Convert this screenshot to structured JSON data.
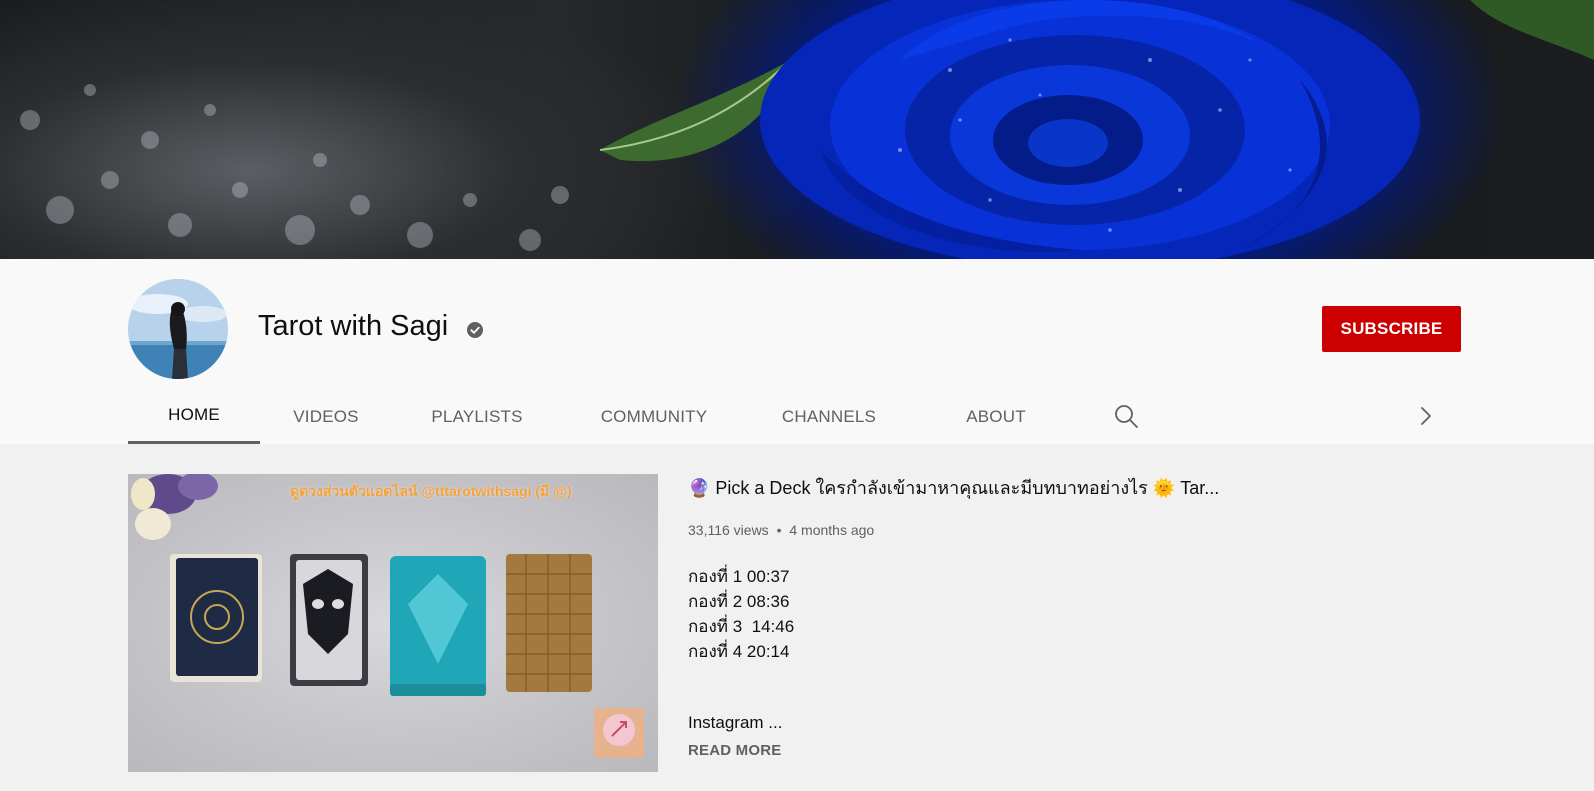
{
  "channel": {
    "name": "Tarot with Sagi",
    "verified_icon": "verified-check-icon",
    "subscribe_label": "SUBSCRIBE",
    "subscribe_color": "#cc0000"
  },
  "tabs": [
    {
      "label": "HOME",
      "active": true
    },
    {
      "label": "VIDEOS",
      "active": false
    },
    {
      "label": "PLAYLISTS",
      "active": false
    },
    {
      "label": "COMMUNITY",
      "active": false
    },
    {
      "label": "CHANNELS",
      "active": false
    },
    {
      "label": "ABOUT",
      "active": false
    }
  ],
  "tab_icons": {
    "search": "search-icon",
    "next": "chevron-right-icon"
  },
  "featured": {
    "thumbnail_overlay": "ดูดวงส่วนตัวแอดไลน์ @tttarotwithsagi (มี @)",
    "title": "🔮 Pick a Deck ใครกำลังเข้ามาหาคุณและมีบทบาทอย่างไร 🌞 Tar...",
    "views": "33,116 views",
    "separator": "•",
    "age": "4 months ago",
    "description_lines": [
      "กองที่ 1 00:37",
      "กองที่ 2 08:36",
      "กองที่ 3  14:46",
      "กองที่ 4 20:14"
    ],
    "description_more": "Instagram ...",
    "read_more": "READ MORE"
  }
}
